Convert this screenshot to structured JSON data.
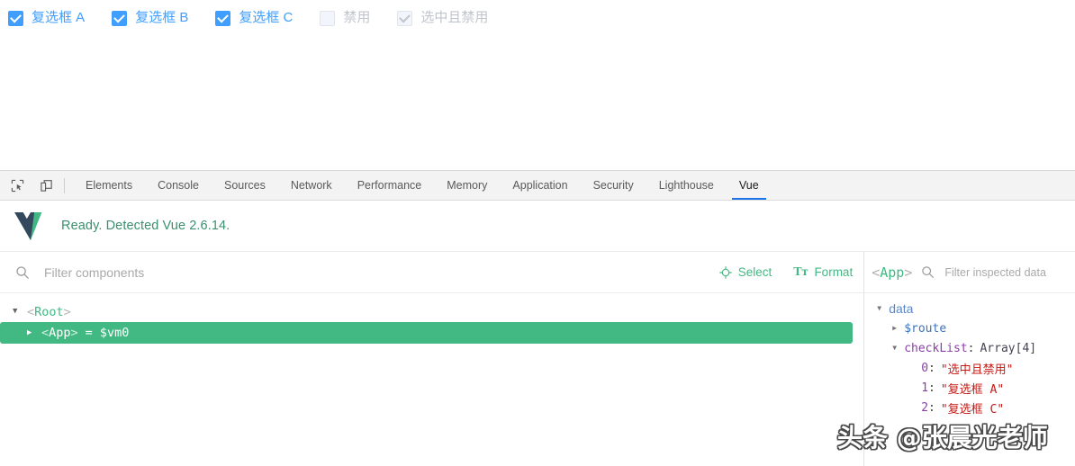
{
  "app": {
    "checkboxes": [
      {
        "label": "复选框 A",
        "checked": true,
        "disabled": false
      },
      {
        "label": "复选框 B",
        "checked": true,
        "disabled": false
      },
      {
        "label": "复选框 C",
        "checked": true,
        "disabled": false
      },
      {
        "label": "禁用",
        "checked": false,
        "disabled": true
      },
      {
        "label": "选中且禁用",
        "checked": true,
        "disabled": true
      }
    ],
    "accent_color": "#409EFF",
    "disabled_color": "#C0C4CC"
  },
  "devtools": {
    "icons": {
      "inspect": "inspect-element-icon",
      "device": "device-toolbar-icon"
    },
    "tabs": [
      {
        "label": "Elements",
        "active": false
      },
      {
        "label": "Console",
        "active": false
      },
      {
        "label": "Sources",
        "active": false
      },
      {
        "label": "Network",
        "active": false
      },
      {
        "label": "Performance",
        "active": false
      },
      {
        "label": "Memory",
        "active": false
      },
      {
        "label": "Application",
        "active": false
      },
      {
        "label": "Security",
        "active": false
      },
      {
        "label": "Lighthouse",
        "active": false
      },
      {
        "label": "Vue",
        "active": true
      }
    ],
    "active_tab_underline": "#1A73E8"
  },
  "vue_panel": {
    "status": {
      "icon": "vue-logo-icon",
      "text": "Ready. Detected Vue 2.6.14.",
      "text_color": "#3C8F6E"
    },
    "toolbar": {
      "search_icon": "search-icon",
      "filter_placeholder": "Filter components",
      "filter_value": "",
      "select_button": {
        "label": "Select",
        "icon": "crosshair-icon"
      },
      "format_button": {
        "label": "Format",
        "icon": "text-format-icon",
        "glyph": "Tт"
      }
    },
    "tree": {
      "rows": [
        {
          "caret": "▼",
          "open": "<",
          "name": "Root",
          "close": ">",
          "suffix": "",
          "selected": false,
          "indent": 0
        },
        {
          "caret": "▶",
          "open": "<",
          "name": "App",
          "close": ">",
          "suffix": "= $vm0",
          "selected": true,
          "indent": 1
        }
      ],
      "selected_bg": "#42B983"
    },
    "inspector": {
      "component_tag_open": "<",
      "component_name": "App",
      "component_tag_close": ">",
      "search_icon": "search-icon",
      "filter_placeholder": "Filter inspected data",
      "filter_value": "",
      "rows": [
        {
          "level": 0,
          "caret": "▼",
          "key": "data",
          "key_style": "section",
          "value": "",
          "value_style": "none"
        },
        {
          "level": 1,
          "caret": "▶",
          "key": "$route",
          "key_style": "blue",
          "value": "",
          "value_style": "none"
        },
        {
          "level": 1,
          "caret": "▼",
          "key": "checkList",
          "key_style": "purple",
          "value": "Array[4]",
          "value_style": "type"
        },
        {
          "level": 2,
          "caret": "",
          "key": "0",
          "key_style": "index",
          "value": "\"选中且禁用\"",
          "value_style": "string"
        },
        {
          "level": 2,
          "caret": "",
          "key": "1",
          "key_style": "index",
          "value": "\"复选框 A\"",
          "value_style": "string"
        },
        {
          "level": 2,
          "caret": "",
          "key": "2",
          "key_style": "index",
          "value": "\"复选框 C\"",
          "value_style": "string"
        }
      ]
    }
  },
  "watermark": {
    "text": "头条 @张晨光老师"
  }
}
